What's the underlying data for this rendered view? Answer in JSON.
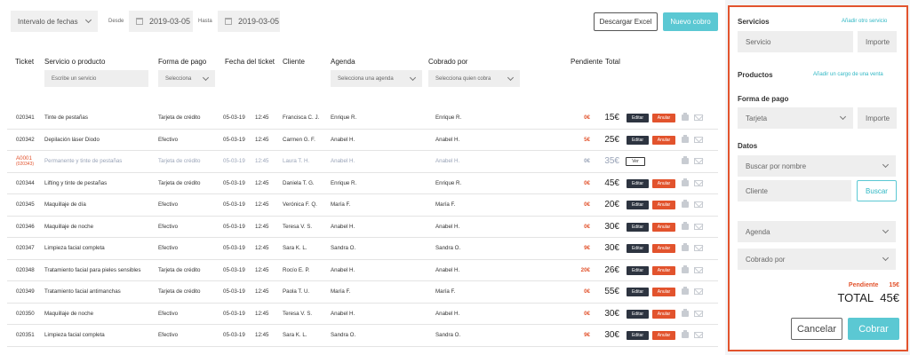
{
  "toolbar": {
    "range_label": "Intervalo de fechas",
    "from_label": "Desde",
    "from_value": "2019-03-05",
    "to_label": "Hasta",
    "to_value": "2019-03-05",
    "excel_label": "Descargar Excel",
    "new_label": "Nuevo cobro"
  },
  "columns": [
    "Ticket",
    "Servicio o producto",
    "Forma de pago",
    "Fecha del ticket",
    "Cliente",
    "Agenda",
    "Cobrado por",
    "Pendiente",
    "Total"
  ],
  "filters": {
    "service": "Escribe un servicio",
    "payment": "Selecciona",
    "agenda": "Selecciona una agenda",
    "collector": "Selecciona quien cobra"
  },
  "actions": {
    "edit": "Editar",
    "cancel": "Anular",
    "view": "Ver"
  },
  "rows": [
    {
      "ticket": "020341",
      "service": "Tinte de pestañas",
      "payment": "Tarjeta de crédito",
      "date": "05-03-19",
      "time": "12:45",
      "client": "Francisca C. J.",
      "agenda": "Enrique R.",
      "collector": "Enrique R.",
      "pending": "0€",
      "total": "15€"
    },
    {
      "ticket": "020342",
      "service": "Depilación láser Diodo",
      "payment": "Efectivo",
      "date": "05-03-19",
      "time": "12:45",
      "client": "Carmen G. F.",
      "agenda": "Anabel H.",
      "collector": "Anabel H.",
      "pending": "5€",
      "total": "25€"
    },
    {
      "ticket": "A0001",
      "ticket_sub": "(020343)",
      "service": "Permanente y tinte de pestañas",
      "payment": "Tarjeta de crédito",
      "date": "05-03-19",
      "time": "12:45",
      "client": "Laura T. H.",
      "agenda": "Anabel H.",
      "collector": "Anabel H.",
      "pending": "0€",
      "total": "35€"
    },
    {
      "ticket": "020344",
      "service": "Lifting y tinte de pestañas",
      "payment": "Tarjeta de crédito",
      "date": "05-03-19",
      "time": "12:45",
      "client": "Daniela T. G.",
      "agenda": "Enrique R.",
      "collector": "Enrique R.",
      "pending": "0€",
      "total": "45€"
    },
    {
      "ticket": "020345",
      "service": "Maquillaje de día",
      "payment": "Efectivo",
      "date": "05-03-19",
      "time": "12:45",
      "client": "Verónica F. Q.",
      "agenda": "María F.",
      "collector": "María F.",
      "pending": "0€",
      "total": "20€"
    },
    {
      "ticket": "020346",
      "service": "Maquillaje de noche",
      "payment": "Efectivo",
      "date": "05-03-19",
      "time": "12:45",
      "client": "Teresa V. S.",
      "agenda": "Anabel H.",
      "collector": "Anabel H.",
      "pending": "0€",
      "total": "30€"
    },
    {
      "ticket": "020347",
      "service": "Limpieza facial completa",
      "payment": "Efectivo",
      "date": "05-03-19",
      "time": "12:45",
      "client": "Sara K. L.",
      "agenda": "Sandra O.",
      "collector": "Sandra O.",
      "pending": "9€",
      "total": "30€"
    },
    {
      "ticket": "020348",
      "service": "Tratamiento facial para pieles sensibles",
      "payment": "Tarjeta de crédito",
      "date": "05-03-19",
      "time": "12:45",
      "client": "Rocío E. P.",
      "agenda": "Anabel H.",
      "collector": "Anabel H.",
      "pending": "20€",
      "total": "26€"
    },
    {
      "ticket": "020349",
      "service": "Tratamiento facial antimanchas",
      "payment": "Tarjeta de crédito",
      "date": "05-03-19",
      "time": "12:45",
      "client": "Paola T. U.",
      "agenda": "María F.",
      "collector": "María F.",
      "pending": "0€",
      "total": "55€"
    },
    {
      "ticket": "020350",
      "service": "Maquillaje de noche",
      "payment": "Efectivo",
      "date": "05-03-19",
      "time": "12:45",
      "client": "Teresa V. S.",
      "agenda": "Anabel H.",
      "collector": "Anabel H.",
      "pending": "0€",
      "total": "30€"
    },
    {
      "ticket": "020351",
      "service": "Limpieza facial completa",
      "payment": "Efectivo",
      "date": "05-03-19",
      "time": "12:45",
      "client": "Sara K. L.",
      "agenda": "Sandra O.",
      "collector": "Sandra O.",
      "pending": "9€",
      "total": "30€"
    }
  ],
  "panel": {
    "services_title": "Servicios",
    "add_service": "Añadir otro servicio",
    "service_placeholder": "Servicio",
    "amount_placeholder": "Importe",
    "products_title": "Productos",
    "add_product": "Añadir un cargo de una venta",
    "payment_title": "Forma de pago",
    "payment_value": "Tarjeta",
    "payment_amount": "Importe",
    "data_title": "Datos",
    "search_name": "Buscar por nombre",
    "client_placeholder": "Cliente",
    "search_button": "Buscar",
    "agenda": "Agenda",
    "collected_by": "Cobrado por",
    "pending_label": "Pendiente",
    "pending_value": "15€",
    "total_label": "TOTAL",
    "total_value": "45€",
    "cancel_button": "Cancelar",
    "charge_button": "Cobrar"
  },
  "colors": {
    "accent": "#e2532d",
    "teal": "#5bc8d3",
    "dark": "#2d3440"
  }
}
